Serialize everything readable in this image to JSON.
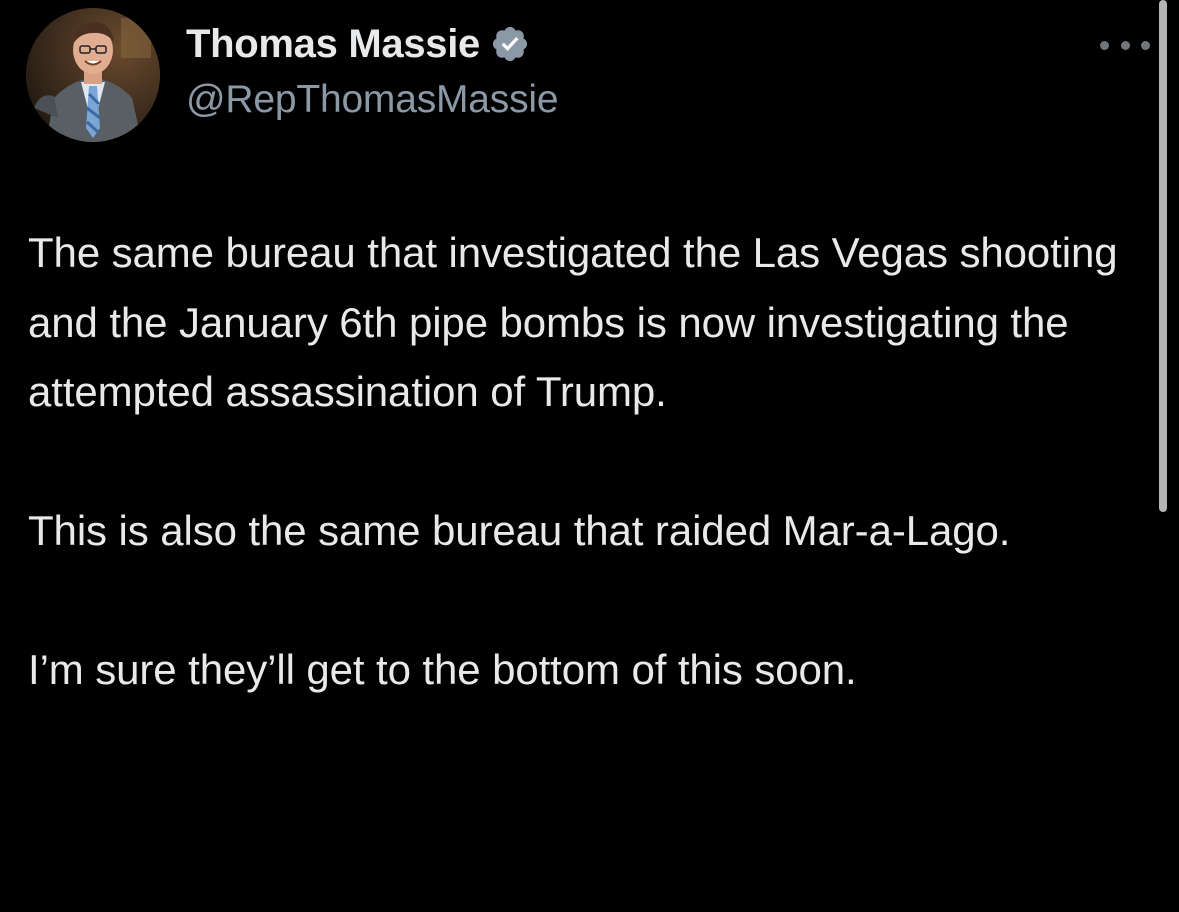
{
  "author": {
    "display_name": "Thomas Massie",
    "handle": "@RepThomasMassie",
    "verified": true,
    "verified_badge_color": "#8b98a5"
  },
  "tweet": {
    "paragraphs": [
      "The same bureau that investigated the Las Vegas shooting and the January 6th pipe bombs is now investigating the attempted assassination of Trump.",
      "This is also the same bureau that raided Mar-a-Lago.",
      "I’m sure they’ll get to the bottom of this soon."
    ]
  },
  "icons": {
    "avatar": "avatar-photo",
    "verified": "verified-badge-icon",
    "more": "more-options-icon"
  },
  "colors": {
    "background": "#000000",
    "primary_text": "#e7e9ea",
    "secondary_text": "#8b98a5"
  }
}
